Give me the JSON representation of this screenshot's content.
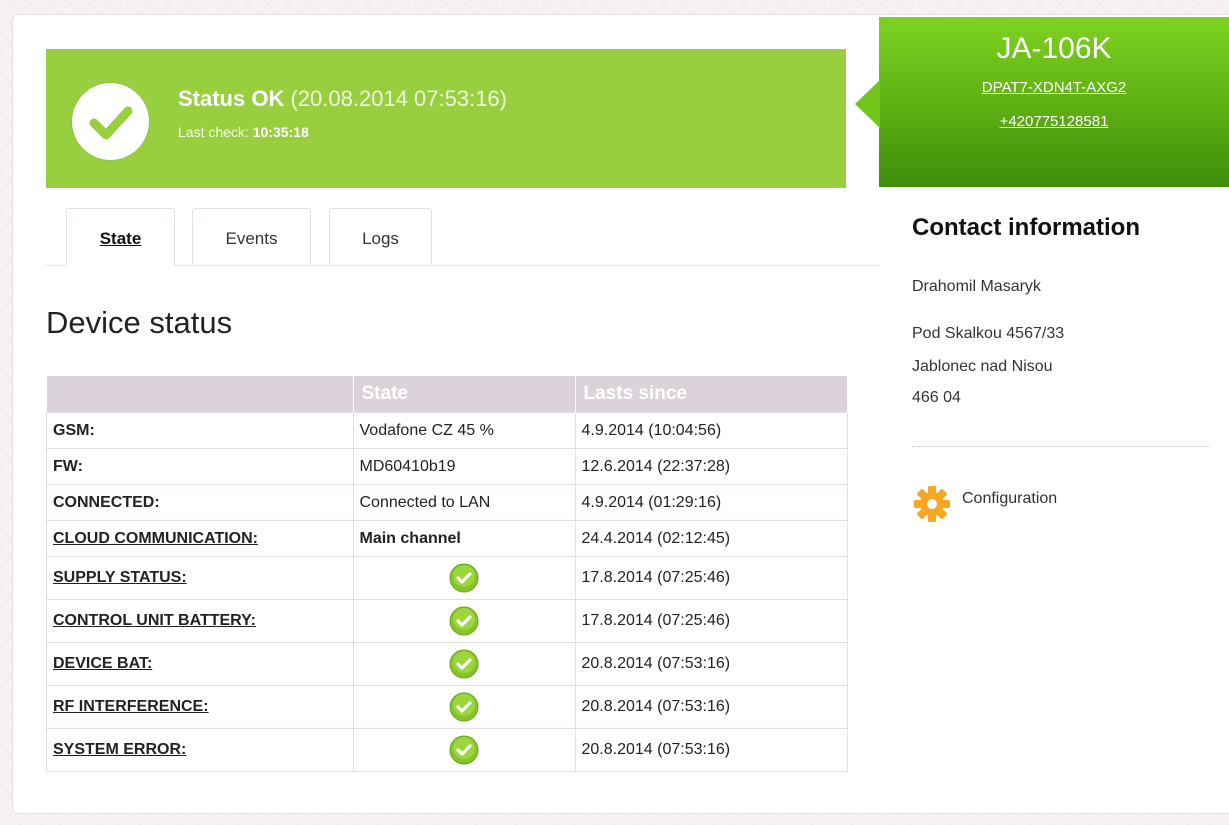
{
  "status": {
    "title": "Status OK",
    "datetime": "(20.08.2014 07:53:16)",
    "last_check_label": "Last check:",
    "last_check_time": "10:35:18"
  },
  "device": {
    "name": "JA-106K",
    "code": "DPAT7-XDN4T-AXG2",
    "phone": "+420775128581"
  },
  "tabs": [
    {
      "label": "State",
      "active": true
    },
    {
      "label": "Events",
      "active": false
    },
    {
      "label": "Logs",
      "active": false
    }
  ],
  "main": {
    "title": "Device status",
    "table": {
      "headers": [
        "",
        "State",
        "Lasts since"
      ],
      "rows": [
        {
          "name": "GSM:",
          "state": "Vodafone CZ 45 %",
          "since": "4.9.2014 (10:04:56)"
        },
        {
          "name": "FW:",
          "state": "MD60410b19",
          "since": "12.6.2014 (22:37:28)"
        },
        {
          "name": "CONNECTED:",
          "state": "Connected to LAN",
          "since": "4.9.2014 (01:29:16)"
        },
        {
          "name": "CLOUD COMMUNICATION:",
          "state": "Main channel",
          "since": "24.4.2014 (02:12:45)"
        },
        {
          "name": "SUPPLY STATUS:",
          "state_icon": "check-circle-icon",
          "since": "17.8.2014 (07:25:46)"
        },
        {
          "name": "CONTROL UNIT BATTERY:",
          "state_icon": "check-circle-icon",
          "since": "17.8.2014 (07:25:46)"
        },
        {
          "name": "DEVICE BAT:",
          "state_icon": "check-circle-icon",
          "since": "20.8.2014 (07:53:16)"
        },
        {
          "name": "RF INTERFERENCE:",
          "state_icon": "check-circle-icon",
          "since": "20.8.2014 (07:53:16)"
        },
        {
          "name": "SYSTEM ERROR:",
          "state_icon": "check-circle-icon",
          "since": "20.8.2014 (07:53:16)"
        }
      ]
    }
  },
  "contact": {
    "title": "Contact information",
    "name": "Drahomil Masaryk",
    "street": "Pod Skalkou 4567/33",
    "city": "Jablonec nad Nisou",
    "zip": "466 04"
  },
  "configuration": {
    "label": "Configuration",
    "icon": "gear-icon"
  },
  "colors": {
    "status_green": "#98cf3f",
    "header_green": "#5aaa12",
    "table_header": "#dcd3da",
    "gear_orange": "#f5a623"
  }
}
